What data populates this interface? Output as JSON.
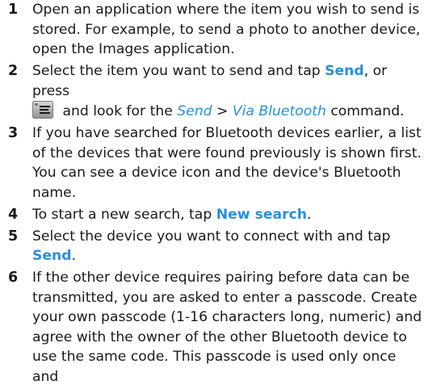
{
  "steps": [
    {
      "num": "1",
      "text": "Open an application where the item you wish to send is stored. For example, to send a photo to another device, open the Images application."
    },
    {
      "num": "2",
      "pre": "Select the item you want to send and tap ",
      "send_label": "Send",
      "mid": ", or press",
      "menu_icon": "options-menu-icon",
      "after_icon": " and look for the ",
      "menu_send": "Send",
      "separator": " > ",
      "menu_via_bluetooth": "Via Bluetooth",
      "post": " command."
    },
    {
      "num": "3",
      "text": "If you have searched for Bluetooth devices earlier, a list of the devices that were found previously is shown first. You can see a device icon and the device's Bluetooth name."
    },
    {
      "num": "4",
      "pre": "To start a new search, tap ",
      "new_search_label": "New search",
      "post": "."
    },
    {
      "num": "5",
      "pre": "Select the device you want to connect with and tap ",
      "send_label": "Send",
      "post": "."
    },
    {
      "num": "6",
      "text": "If the other device requires pairing before data can be transmitted, you are asked to enter a passcode. Create your own passcode (1-16 characters long, numeric) and agree with the owner of the other Bluetooth device to use the same code. This passcode is used only once and"
    }
  ],
  "colors": {
    "keyword": "#2b8fd9",
    "text": "#1a1a1a"
  }
}
